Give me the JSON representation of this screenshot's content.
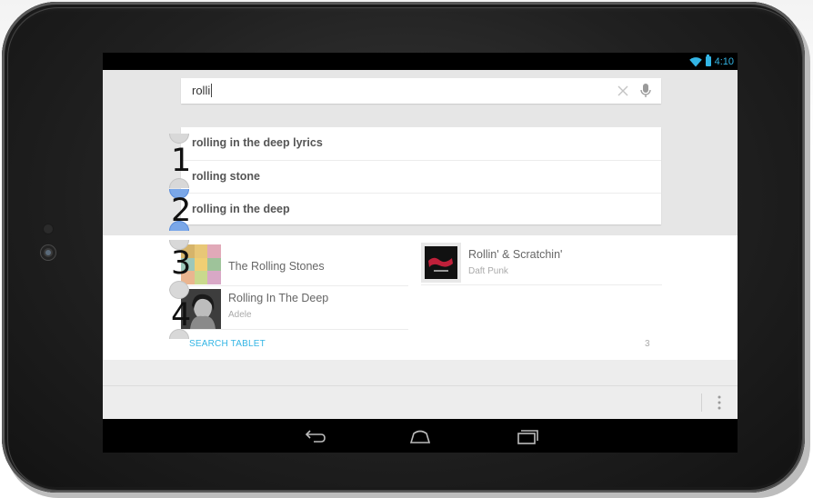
{
  "status_bar": {
    "time": "4:10",
    "accent_color": "#33b5e5"
  },
  "search": {
    "query": "rolli"
  },
  "suggestions": [
    {
      "text": "rolling in the deep lyrics"
    },
    {
      "text": "rolling stone"
    },
    {
      "text": "rolling in the deep"
    }
  ],
  "results": [
    {
      "title": "The Rolling Stones",
      "subtitle": "",
      "thumbnail": "rolling-stones-thumbnail"
    },
    {
      "title": "Rollin' & Scratchin'",
      "subtitle": "Daft Punk",
      "thumbnail": "daft-punk-album-art"
    },
    {
      "title": "Rolling In The Deep",
      "subtitle": "Adele",
      "thumbnail": "adele-album-art"
    }
  ],
  "footer": {
    "search_tablet_label": "SEARCH TABLET",
    "result_count": "3"
  },
  "markers": [
    "1",
    "2",
    "3",
    "4"
  ],
  "nav": [
    "back-icon",
    "home-icon",
    "recent-apps-icon"
  ]
}
